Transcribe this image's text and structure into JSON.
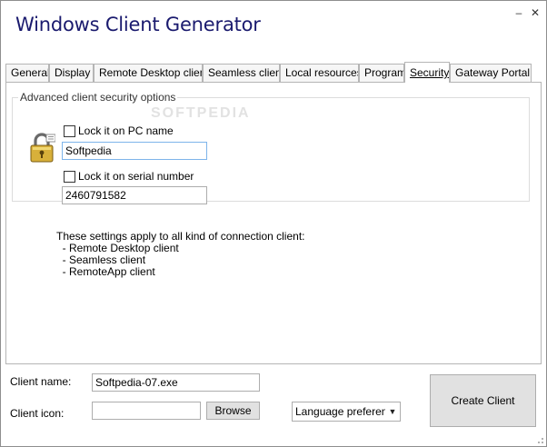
{
  "window": {
    "title": "Windows Client Generator",
    "minimize_glyph": "–",
    "close_glyph": "✕"
  },
  "tabs": [
    {
      "label": "General"
    },
    {
      "label": "Display"
    },
    {
      "label": "Remote Desktop client"
    },
    {
      "label": "Seamless client"
    },
    {
      "label": "Local resources"
    },
    {
      "label": "Program"
    },
    {
      "label": "Security",
      "active": true
    },
    {
      "label": "Gateway Portal"
    }
  ],
  "security": {
    "group_title": "Advanced client security options",
    "watermark": "SOFTPEDIA",
    "icon": "padlock-icon",
    "lock_pc": {
      "label": "Lock it on PC name",
      "checked": false,
      "value": "Softpedia"
    },
    "lock_serial": {
      "label": "Lock it on serial number",
      "checked": false,
      "value": "2460791582"
    },
    "info_lines": [
      "These settings apply to all kind of connection client:",
      "  - Remote Desktop client",
      "  - Seamless client",
      "  - RemoteApp client"
    ]
  },
  "bottom": {
    "client_name_label": "Client name:",
    "client_name_value": "Softpedia-07.exe",
    "client_icon_label": "Client icon:",
    "client_icon_value": "",
    "browse_label": "Browse",
    "language_value": "Language preference",
    "create_label": "Create Client"
  }
}
